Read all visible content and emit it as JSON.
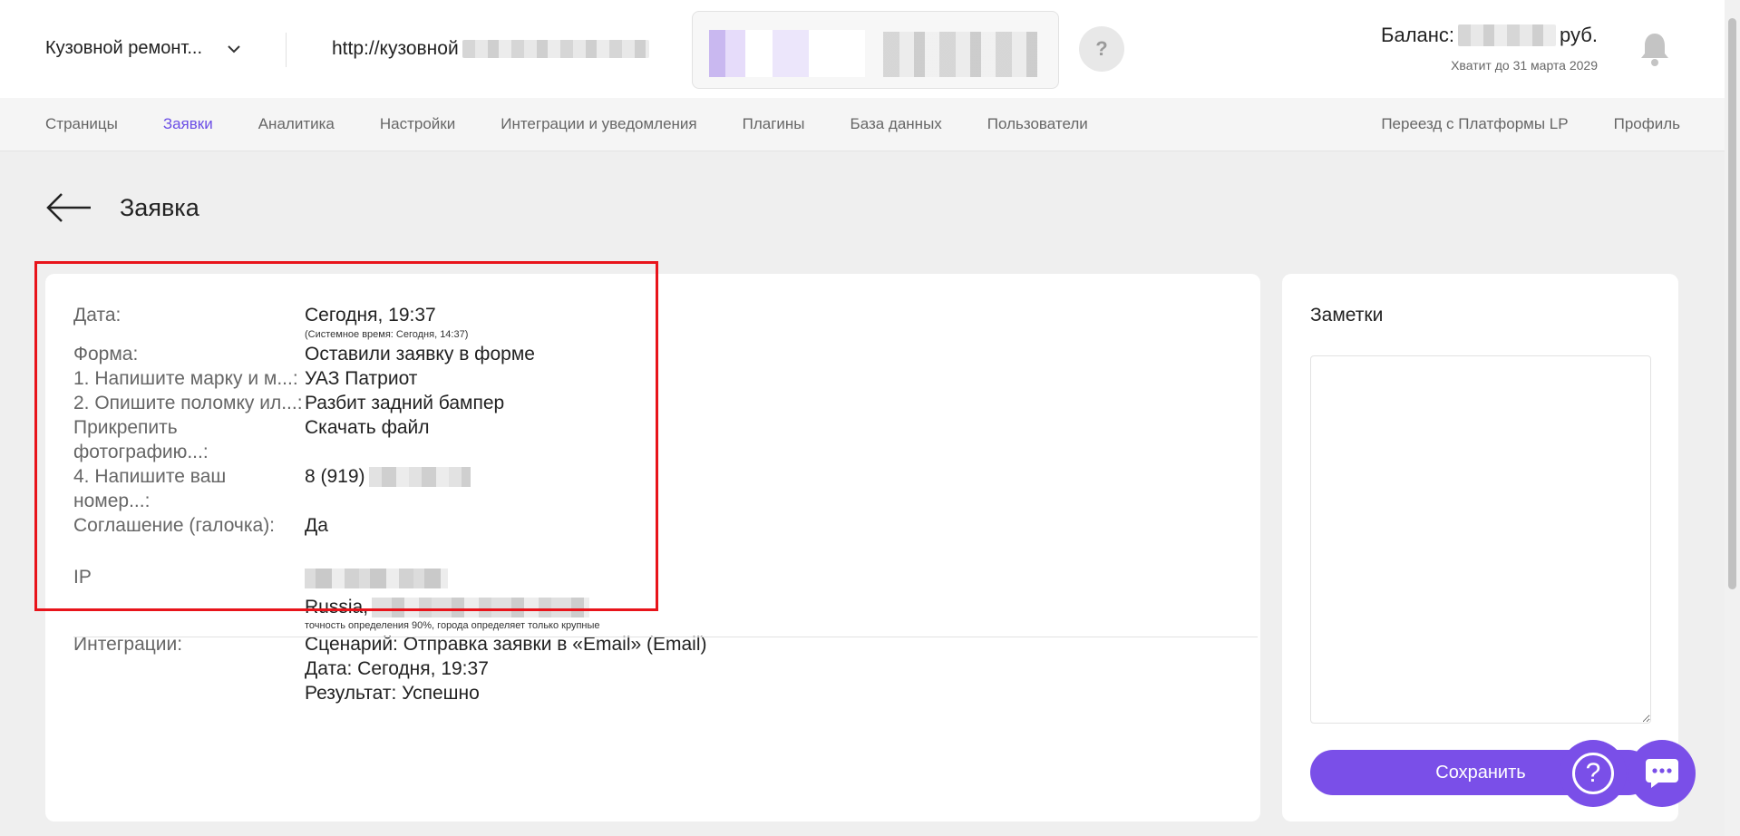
{
  "header": {
    "project_name": "Кузовной ремонт...",
    "url_prefix": "http://кузовной",
    "help_label": "?",
    "balance_prefix": "Баланс:",
    "balance_suffix": "руб.",
    "balance_until": "Хватит до 31 марта 2029"
  },
  "nav": {
    "left": [
      "Страницы",
      "Заявки",
      "Аналитика",
      "Настройки",
      "Интеграции и уведомления",
      "Плагины",
      "База данных",
      "Пользователи"
    ],
    "right": [
      "Переезд с Платформы LP",
      "Профиль"
    ],
    "active": "Заявки"
  },
  "page": {
    "title": "Заявка"
  },
  "lead": {
    "date_label": "Дата:",
    "date_value": "Сегодня, 19:37",
    "system_time": "(Системное время: Сегодня, 14:37)",
    "form_label": "Форма:",
    "form_value": "Оставили заявку в форме",
    "q1_label": "1. Напишите марку и м...:",
    "q1_value": "УАЗ Патриот",
    "q2_label": "2. Опишите поломку ил...:",
    "q2_value": "Разбит задний бампер",
    "q3_label": "Прикрепить фотографию...:",
    "q3_value": "Скачать файл",
    "q4_label": "4. Напишите ваш номер...:",
    "q4_value": "8 (919)",
    "agree_label": "Соглашение (галочка):",
    "agree_value": "Да"
  },
  "meta": {
    "ip_label": "IP",
    "country": "Russia,",
    "geo_note": "точность определения 90%, города определяет только крупные",
    "integrations_label": "Интеграции:",
    "scenario": "Сценарий: Отправка заявки в «Email» (Email)",
    "int_date": "Дата: Сегодня, 19:37",
    "result": "Результат: Успешно"
  },
  "notes": {
    "title": "Заметки",
    "value": "",
    "save_label": "Сохранить"
  },
  "widgets": {
    "help_glyph": "?"
  },
  "colors": {
    "accent": "#7a4fe8",
    "nav_active": "#6b4ee6",
    "highlight": "#e8141b"
  }
}
